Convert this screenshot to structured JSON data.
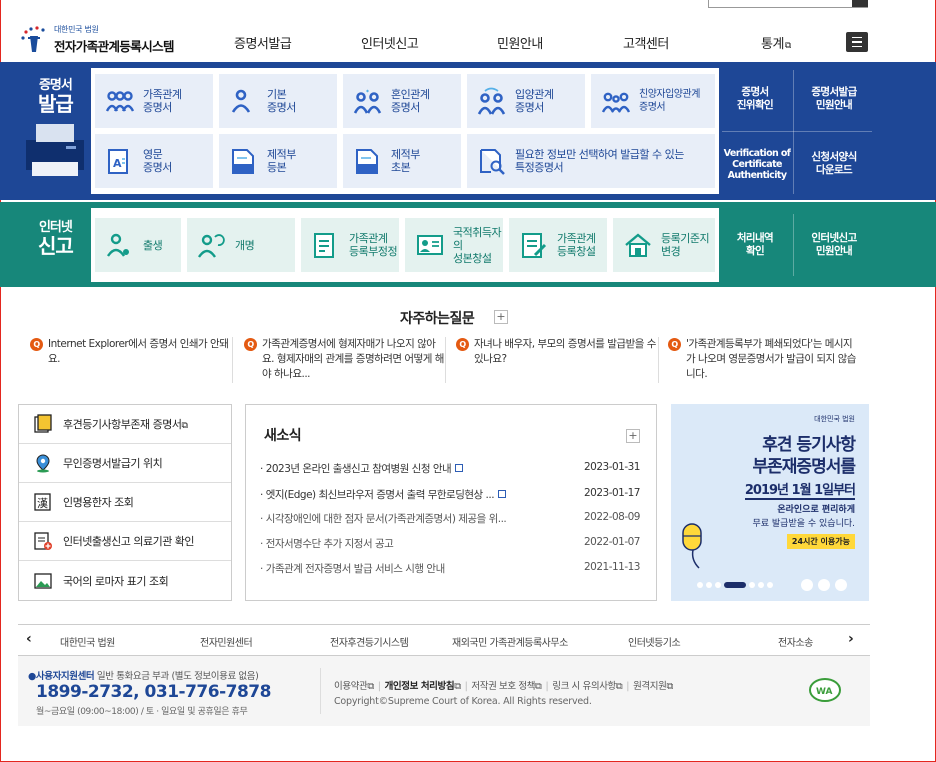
{
  "header": {
    "logo_small": "대한민국 법원",
    "logo_big": "전자가족관계등록시스템",
    "nav": [
      "증명서발급",
      "인터넷신고",
      "민원안내",
      "고객센터",
      "통계"
    ]
  },
  "cert": {
    "title_small": "증명서",
    "title_big": "발급",
    "cards": [
      {
        "label": "가족관계\n증명서",
        "icon": "family-icon"
      },
      {
        "label": "기본\n증명서",
        "icon": "person-icon"
      },
      {
        "label": "혼인관계\n증명서",
        "icon": "couple-icon"
      },
      {
        "label": "입양관계\n증명서",
        "icon": "adoption-icon"
      },
      {
        "label": "친양자입양관계\n증명서",
        "icon": "family-adoption-icon"
      },
      {
        "label": "영문\n증명서",
        "icon": "english-document-icon"
      },
      {
        "label": "제적부\n등본",
        "icon": "removal-register-icon"
      },
      {
        "label": "제적부\n초본",
        "icon": "removal-register-icon"
      },
      {
        "label": "필요한 정보만 선택하여 발급할 수 있는\n특정증명서",
        "icon": "search-document-icon"
      }
    ],
    "side": [
      {
        "label": "증명서\n진위확인"
      },
      {
        "label": "증명서발급\n민원안내"
      },
      {
        "label": "Verification of\nCertificate\nAuthenticity"
      },
      {
        "label": "신청서양식\n다운로드"
      }
    ]
  },
  "report": {
    "title_small": "인터넷",
    "title_big": "신고",
    "cards": [
      {
        "label": "출생",
        "icon": "birth-icon"
      },
      {
        "label": "개명",
        "icon": "rename-icon"
      },
      {
        "label": "가족관계\n등록부정정",
        "icon": "correction-document-icon"
      },
      {
        "label": "국적취득자의\n성본창설",
        "icon": "id-card-icon"
      },
      {
        "label": "가족관계\n등록창설",
        "icon": "register-create-icon"
      },
      {
        "label": "등록기준지\n변경",
        "icon": "house-icon"
      }
    ],
    "side": [
      {
        "label": "처리내역\n확인"
      },
      {
        "label": "인터넷신고\n민원안내"
      }
    ]
  },
  "faq": {
    "title": "자주하는질문",
    "items": [
      "Internet Explorer에서 증명서 인쇄가 안돼요.",
      "가족관계증명서에 형제자매가 나오지 않아요. 형제자매의 관계를 증명하려면 어떻게 해야 하나요...",
      "자녀나 배우자, 부모의 증명서를 발급받을 수 있나요?",
      "'가족관계등록부가 폐쇄되었다'는 메시지가 나오며 영문증명서가 발급이 되지 않습니다."
    ]
  },
  "quick": [
    {
      "label": "후견등기사항부존재 증명서"
    },
    {
      "label": "무인증명서발급기 위치"
    },
    {
      "label": "인명용한자 조회"
    },
    {
      "label": "인터넷출생신고 의료기관 확인"
    },
    {
      "label": "국어의 로마자 표기 조회"
    }
  ],
  "news": {
    "title": "새소식",
    "items": [
      {
        "title": "2023년 온라인 출생신고 참여병원 신청 안내",
        "date": "2023-01-31",
        "new": true
      },
      {
        "title": "엣지(Edge) 최신브라우저 증명서 출력 무한로딩현상 ...",
        "date": "2023-01-17",
        "new": true
      },
      {
        "title": "시각장애인에 대한 점자 문서(가족관계증명서) 제공을 위...",
        "date": "2022-08-09",
        "new": false
      },
      {
        "title": "전자서명수단 추가 지정서 공고",
        "date": "2022-01-07",
        "new": false
      },
      {
        "title": "가족관계 전자증명서 발급 서비스 시행 안내",
        "date": "2021-11-13",
        "new": false
      }
    ]
  },
  "banner": {
    "org": "대한민국 법원",
    "line1": "후견 등기사항",
    "line2": "부존재증명서를",
    "line3": "2019년 1월 1일부터",
    "line4": "온라인으로 편리하게",
    "line5": "무료 발급받을 수 있습니다.",
    "pill": "24시간 이용가능"
  },
  "family": [
    "대한민국 법원",
    "전자민원센터",
    "전자후견등기시스템",
    "재외국민 가족관계등록사무소",
    "인터넷등기소",
    "전자소송"
  ],
  "footer": {
    "center": "사용자지원센터",
    "center_note": "일반 통화요금 부과 (별도 정보이용료 없음)",
    "phone": "1899-2732, 031-776-7878",
    "hours": "월~금요일 (09:00~18:00) / 토 · 일요일 및 공휴일은 휴무",
    "links": [
      "이용약관",
      "개인정보 처리방침",
      "저작권 보호 정책",
      "링크 시 유의사항",
      "원격지원"
    ],
    "copyright": "Copyright©Supreme Court of Korea. All Rights reserved."
  },
  "colors": {
    "cert_band": "#1e4796",
    "report_band": "#17877a",
    "faq_q": "#e45a12"
  }
}
